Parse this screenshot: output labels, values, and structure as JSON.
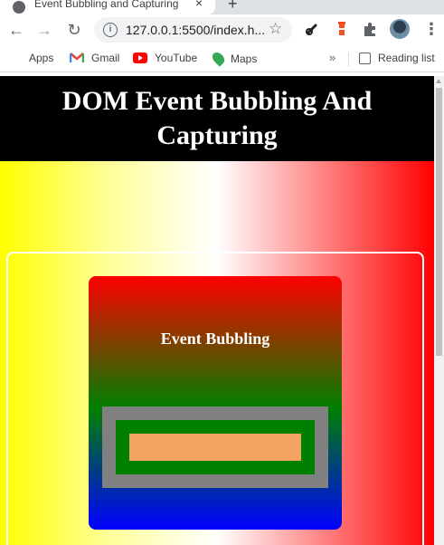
{
  "browser": {
    "tab": {
      "title": "Event Bubbling and Capturing",
      "close": "×"
    },
    "new_tab": "+",
    "nav": {
      "back": "←",
      "forward": "→",
      "reload": "↻"
    },
    "omnibox": {
      "info": "i",
      "url": "127.0.0.1:5500/index.h...",
      "star": "☆"
    },
    "menu": "⋮"
  },
  "bookmarks": {
    "items": [
      {
        "label": "Apps",
        "icon": "apps-grid-icon"
      },
      {
        "label": "Gmail",
        "icon": "gmail-icon"
      },
      {
        "label": "YouTube",
        "icon": "youtube-icon"
      },
      {
        "label": "Maps",
        "icon": "maps-icon"
      }
    ],
    "more": "»",
    "reading_list": "Reading list"
  },
  "page": {
    "title": "DOM Event Bubbling And Capturing",
    "card_title": "Event Bubbling"
  },
  "colors": {
    "header_bg": "#000000",
    "card_top": "#ff0000",
    "card_mid": "#008000",
    "card_bottom": "#0000ff",
    "grey_box": "#808080",
    "green_box": "#008000",
    "orange_box": "#f4a460"
  }
}
